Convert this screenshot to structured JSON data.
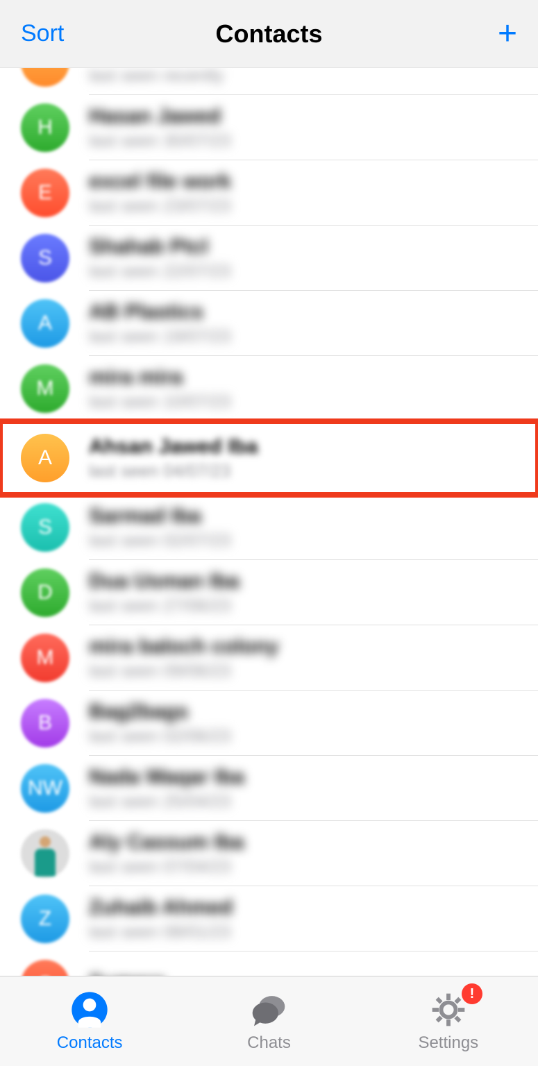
{
  "header": {
    "sort": "Sort",
    "title": "Contacts",
    "plus": "+"
  },
  "contacts": [
    {
      "name": "—",
      "status": "last seen recently",
      "initial": "",
      "color": "linear-gradient(180deg,#ffb24d,#ff8a2b)"
    },
    {
      "name": "Hasan Jawed",
      "status": "last seen 30/07/23",
      "initial": "H",
      "color": "linear-gradient(180deg,#5fcf5f,#2eab2e)"
    },
    {
      "name": "excel file work",
      "status": "last seen 23/07/23",
      "initial": "E",
      "color": "linear-gradient(180deg,#ff7a59,#ff4d2e)"
    },
    {
      "name": "Shahab Ptcl",
      "status": "last seen 22/07/23",
      "initial": "S",
      "color": "linear-gradient(180deg,#6a7bff,#4b55e8)"
    },
    {
      "name": "AB Plastics",
      "status": "last seen 19/07/23",
      "initial": "A",
      "color": "linear-gradient(180deg,#4fc3f7,#1e9ae5)"
    },
    {
      "name": "mira mira",
      "status": "last seen 10/07/23",
      "initial": "M",
      "color": "linear-gradient(180deg,#5fcf5f,#2eab2e)"
    },
    {
      "name": "Ahsan Jawed Iba",
      "status": "last seen 04/07/23",
      "initial": "A",
      "color": "linear-gradient(180deg,#ffc24d,#ff9f2b)",
      "highlighted": true
    },
    {
      "name": "Sarmad Iba",
      "status": "last seen 02/07/23",
      "initial": "S",
      "color": "linear-gradient(180deg,#3fe0d0,#1bbfae)"
    },
    {
      "name": "Dua Usman Iba",
      "status": "last seen 27/06/23",
      "initial": "D",
      "color": "linear-gradient(180deg,#5fcf5f,#2eab2e)"
    },
    {
      "name": "mira baloch colony",
      "status": "last seen 09/06/23",
      "initial": "M",
      "color": "linear-gradient(180deg,#ff6b5b,#f23b2f)"
    },
    {
      "name": "Bag2bags",
      "status": "last seen 02/06/23",
      "initial": "B",
      "color": "linear-gradient(180deg,#c77dff,#a23be8)"
    },
    {
      "name": "Nada Waqar Iba",
      "status": "last seen 25/04/23",
      "initial": "NW",
      "color": "linear-gradient(180deg,#4fc3f7,#1e9ae5)"
    },
    {
      "name": "Aly Cassum Iba",
      "status": "last seen 07/04/23",
      "initial": "",
      "color": "photo"
    },
    {
      "name": "Zuhaib Ahmed",
      "status": "last seen 08/01/23",
      "initial": "Z",
      "color": "linear-gradient(180deg,#4fc3f7,#1e9ae5)"
    },
    {
      "name": "Sumera",
      "status": "",
      "initial": "S",
      "color": "linear-gradient(180deg,#ff7a59,#ff4d2e)"
    }
  ],
  "tabs": {
    "contacts": "Contacts",
    "chats": "Chats",
    "settings": "Settings",
    "badge": "!"
  }
}
